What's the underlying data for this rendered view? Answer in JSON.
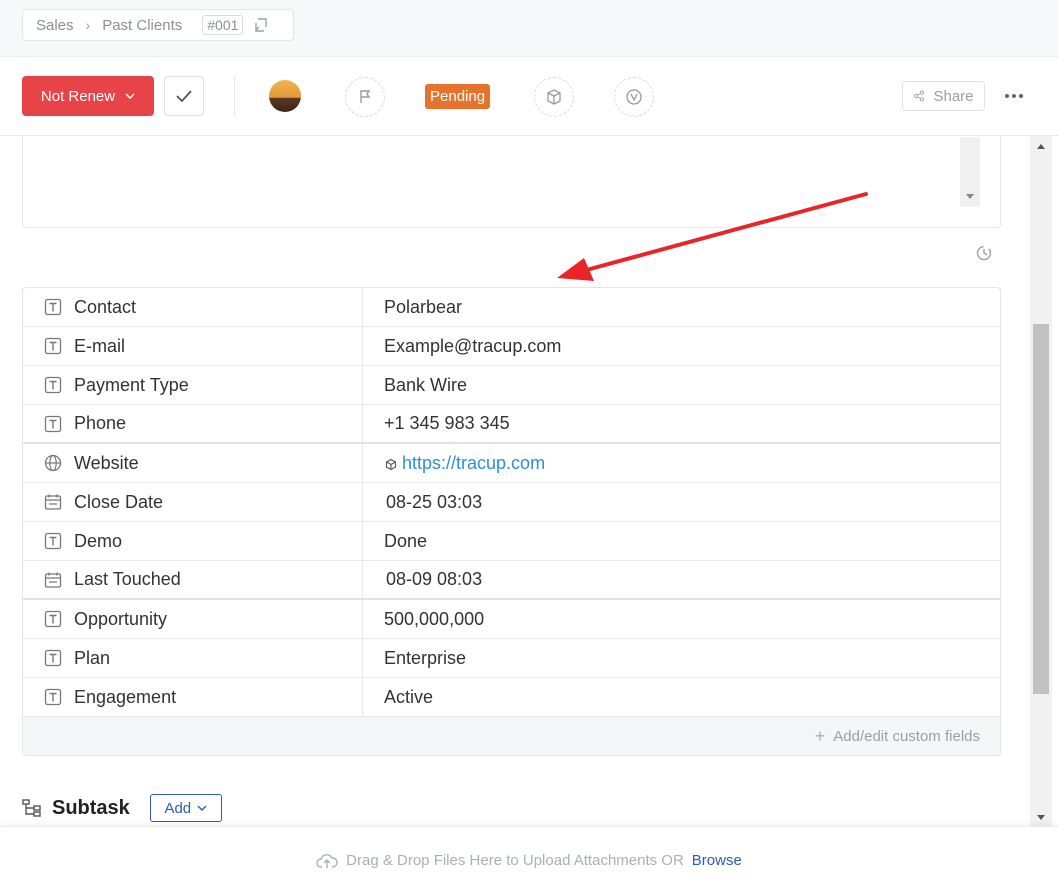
{
  "breadcrumb": {
    "root": "Sales",
    "section": "Past Clients",
    "id": "#001"
  },
  "toolbar": {
    "status_label": "Not Renew",
    "priority_badge": "Pending",
    "share_label": "Share"
  },
  "fields": [
    {
      "icon": "text-field-icon",
      "name": "Contact",
      "value": "Polarbear"
    },
    {
      "icon": "text-field-icon",
      "name": "E-mail",
      "value": "Example@tracup.com"
    },
    {
      "icon": "text-field-icon",
      "name": "Payment Type",
      "value": "Bank Wire"
    },
    {
      "icon": "text-field-icon",
      "name": "Phone",
      "value": "+1 345 983 345"
    },
    {
      "icon": "globe-icon",
      "name": "Website",
      "value": "https://tracup.com"
    },
    {
      "icon": "calendar-icon",
      "name": "Close Date",
      "value": "08-25 03:03"
    },
    {
      "icon": "text-field-icon",
      "name": "Demo",
      "value": "Done"
    },
    {
      "icon": "calendar-icon",
      "name": "Last Touched",
      "value": "08-09 08:03"
    },
    {
      "icon": "text-field-icon",
      "name": "Opportunity",
      "value": "500,000,000"
    },
    {
      "icon": "text-field-icon",
      "name": "Plan",
      "value": "Enterprise"
    },
    {
      "icon": "text-field-icon",
      "name": "Engagement",
      "value": "Active"
    }
  ],
  "add_fields_label": "Add/edit custom fields",
  "subtask": {
    "title": "Subtask",
    "add_label": "Add"
  },
  "upload": {
    "text": "Drag & Drop Files Here to Upload Attachments OR",
    "browse": "Browse"
  },
  "colors": {
    "status": "#e9434a",
    "pending": "#e5732b",
    "link": "#2f8fd6",
    "accent": "#2c5bb8",
    "annotation_arrow": "#e8262a"
  }
}
